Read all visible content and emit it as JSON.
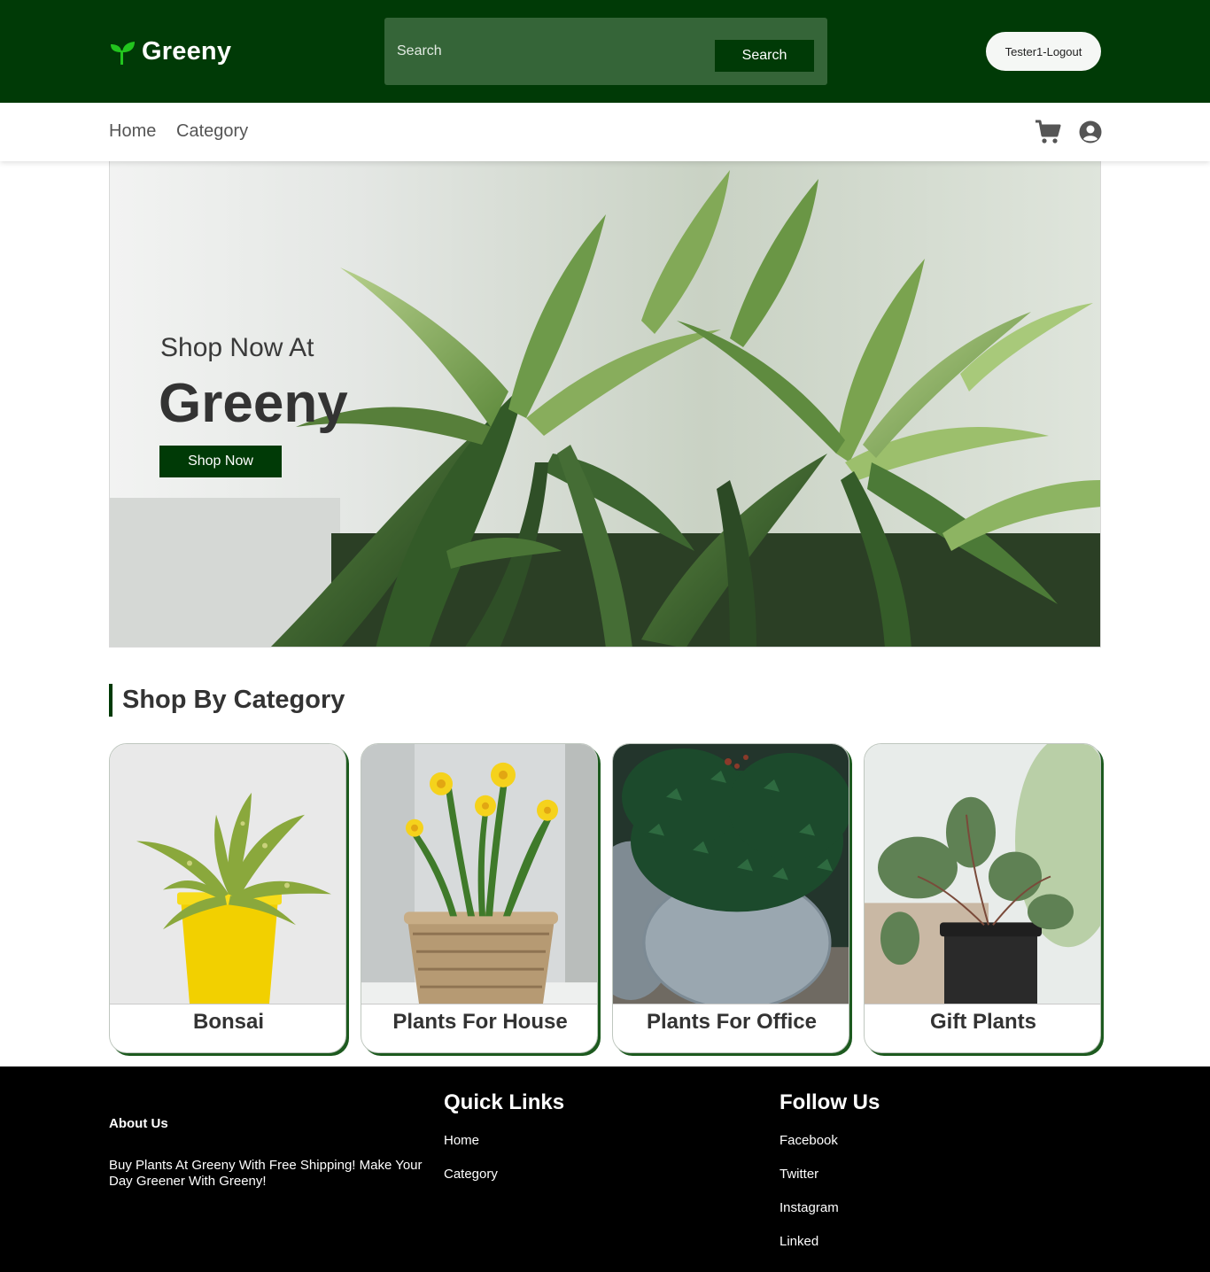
{
  "header": {
    "brand": "Greeny",
    "search_placeholder": "Search",
    "search_button": "Search",
    "logout_button": "Tester1-Logout"
  },
  "nav": {
    "home": "Home",
    "category": "Category",
    "icons": [
      "cart-icon",
      "user-icon"
    ]
  },
  "hero": {
    "subtitle": "Shop Now At",
    "title": "Greeny",
    "cta": "Shop Now"
  },
  "categories": {
    "title": "Shop By Category",
    "items": [
      {
        "label": "Bonsai"
      },
      {
        "label": "Plants For House"
      },
      {
        "label": "Plants For Office"
      },
      {
        "label": "Gift Plants"
      }
    ]
  },
  "footer": {
    "about_title": "About Us",
    "about_text": "Buy Plants At Greeny With Free Shipping! Make Your Day Greener With Greeny!",
    "quick_links_title": "Quick Links",
    "quick_links": [
      "Home",
      "Category"
    ],
    "follow_title": "Follow Us",
    "social": [
      "Facebook",
      "Twitter",
      "Instagram",
      "Linked"
    ]
  },
  "colors": {
    "brand_dark_green": "#003a06",
    "search_box_green": "#356538",
    "footer_bg": "#000000",
    "logo_leaf": "#22c41e"
  }
}
